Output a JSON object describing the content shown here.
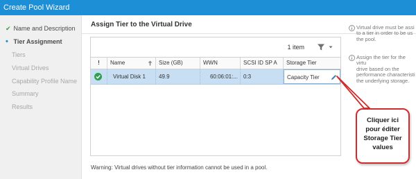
{
  "window": {
    "title": "Create Pool Wizard",
    "accent": "#1d8fd6"
  },
  "nav": {
    "items": [
      {
        "label": "Name and Description",
        "state": "done"
      },
      {
        "label": "Tier Assignment",
        "state": "active"
      },
      {
        "label": "Tiers",
        "state": "pending"
      },
      {
        "label": "Virtual Drives",
        "state": "pending"
      },
      {
        "label": "Capability Profile Name",
        "state": "pending"
      },
      {
        "label": "Summary",
        "state": "pending"
      },
      {
        "label": "Results",
        "state": "pending"
      }
    ]
  },
  "main": {
    "title": "Assign Tier to the Virtual Drive",
    "grid": {
      "count": "1 item",
      "columns": [
        "!",
        "Name",
        "Size (GB)",
        "WWN",
        "SCSI ID SP A",
        "Storage Tier"
      ],
      "rows": [
        {
          "status": "ok",
          "name": "Virtual Disk 1",
          "size": "49.9",
          "wwn": "60:06:01:...",
          "scsi_id": "0:3",
          "storage_tier": "Capacity Tier"
        }
      ]
    },
    "warning": "Warning: Virtual drives without tier information cannot be used in a pool."
  },
  "info_panel": {
    "notes": [
      "Virtual drive must be assi\nto a tier in order to be us\nthe pool.",
      "Assign the tier for the virtu\ndrive based on the\nperformance characteristi\nthe underlying storage."
    ]
  },
  "callout": {
    "text": "Cliquer ici\npour éditer\nStorage Tier\nvalues",
    "border_color": "#d22b2b"
  }
}
